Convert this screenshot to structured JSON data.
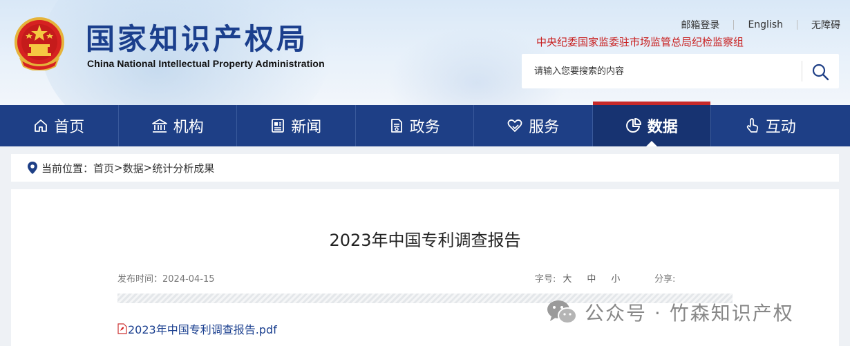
{
  "header": {
    "title_cn": "国家知识产权局",
    "title_en": "China National Intellectual Property Administration",
    "top_links": [
      "邮箱登录",
      "English",
      "无障碍"
    ],
    "discipline_text": "中央纪委国家监委驻市场监管总局纪检监察组",
    "search": {
      "placeholder": "请输入您要搜索的内容"
    }
  },
  "nav": {
    "items": [
      {
        "label": "首页",
        "icon": "home-icon"
      },
      {
        "label": "机构",
        "icon": "institution-icon"
      },
      {
        "label": "新闻",
        "icon": "news-icon"
      },
      {
        "label": "政务",
        "icon": "document-icon"
      },
      {
        "label": "服务",
        "icon": "heart-hand-icon"
      },
      {
        "label": "数据",
        "icon": "pie-chart-icon",
        "active": true
      },
      {
        "label": "互动",
        "icon": "hand-pointer-icon"
      }
    ]
  },
  "breadcrumb": {
    "prefix": "当前位置：",
    "items": [
      "首页",
      ">",
      "数据",
      ">",
      "统计分析成果"
    ]
  },
  "article": {
    "title": "2023年中国专利调查报告",
    "date_label": "发布时间：",
    "date": "2024-04-15",
    "font_size_label": "字号:",
    "font_sizes": [
      "大",
      "中",
      "小"
    ],
    "share_label": "分享:",
    "attachment": "2023年中国专利调查报告.pdf"
  },
  "watermark": {
    "text": "公众号 · 竹森知识产权"
  },
  "colors": {
    "nav_bg": "#1e3f86",
    "nav_active_bg": "#173371",
    "nav_active_accent": "#c72a2a",
    "title_blue": "#1b3f8d",
    "discipline_red": "#c81e1e",
    "link_blue": "#1a3f8f"
  }
}
